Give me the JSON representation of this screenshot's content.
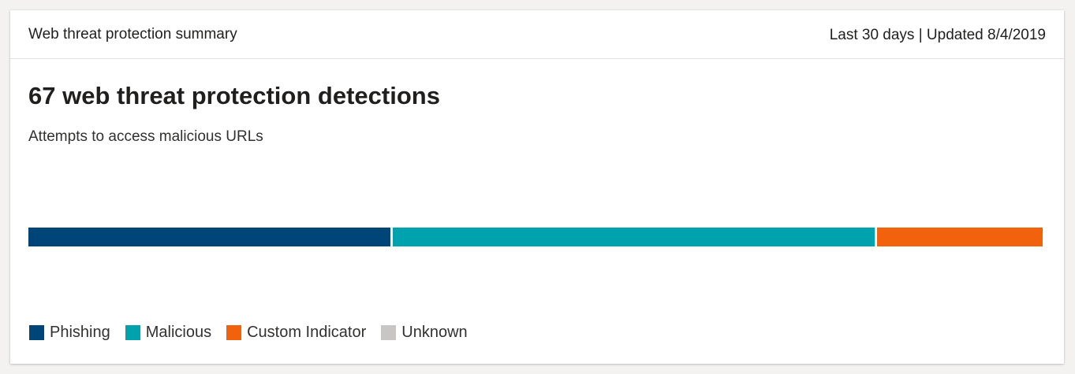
{
  "card": {
    "title": "Web threat protection summary",
    "meta": "Last 30 days | Updated 8/4/2019"
  },
  "summary": {
    "headline": "67 web threat protection detections",
    "subtitle": "Attempts to access malicious URLs"
  },
  "colors": {
    "Phishing": "#004578",
    "Malicious": "#00a2ad",
    "Custom Indicator": "#f2610c",
    "Unknown": "#c8c6c4"
  },
  "chart_data": {
    "type": "bar",
    "orientation": "horizontal-stacked",
    "categories": [
      "Phishing",
      "Malicious",
      "Custom Indicator",
      "Unknown"
    ],
    "values": [
      24,
      32,
      11,
      0
    ],
    "total": 67
  },
  "legend": [
    {
      "label": "Phishing"
    },
    {
      "label": "Malicious"
    },
    {
      "label": "Custom Indicator"
    },
    {
      "label": "Unknown"
    }
  ]
}
